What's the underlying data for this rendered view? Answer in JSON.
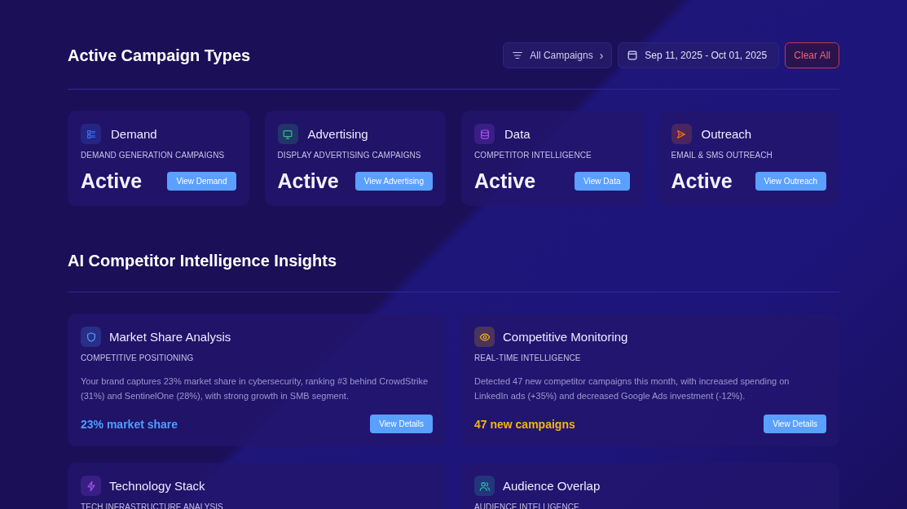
{
  "header": {
    "title": "Active Campaign Types",
    "filter": {
      "label": "All Campaigns",
      "caret": "›"
    },
    "date_range": "Sep 11, 2025 - Oct 01, 2025",
    "clear_button": "Clear All"
  },
  "campaign_types": [
    {
      "kind": "list",
      "color": "#3b6ef5",
      "title": "Demand",
      "subtitle": "DEMAND GENERATION CAMPAIGNS",
      "status": "Active",
      "button": "View Demand"
    },
    {
      "kind": "monitor",
      "color": "#2fbf7a",
      "title": "Advertising",
      "subtitle": "DISPLAY ADVERTISING CAMPAIGNS",
      "status": "Active",
      "button": "View Advertising"
    },
    {
      "kind": "database",
      "color": "#a24ff0",
      "title": "Data",
      "subtitle": "COMPETITOR INTELLIGENCE",
      "status": "Active",
      "button": "View Data"
    },
    {
      "kind": "send",
      "color": "#f26a1b",
      "title": "Outreach",
      "subtitle": "EMAIL & SMS OUTREACH",
      "status": "Active",
      "button": "View Outreach"
    }
  ],
  "insights_section": {
    "title": "AI Competitor Intelligence Insights"
  },
  "insights": [
    {
      "kind": "shield",
      "color": "#4f9dff",
      "title": "Market Share Analysis",
      "subtitle": "COMPETITIVE POSITIONING",
      "description": "Your brand captures 23% market share in cybersecurity, ranking #3 behind CrowdStrike (31%) and SentinelOne (28%), with strong growth in SMB segment.",
      "metric": "23% market share",
      "button": "View Details"
    },
    {
      "kind": "eye",
      "color": "#f5b50b",
      "title": "Competitive Monitoring",
      "subtitle": "REAL-TIME INTELLIGENCE",
      "description": "Detected 47 new competitor campaigns this month, with increased spending on LinkedIn ads (+35%) and decreased Google Ads investment (-12%).",
      "metric": "47 new campaigns",
      "button": "View Details"
    },
    {
      "kind": "bolt",
      "color": "#a24ff0",
      "title": "Technology Stack",
      "subtitle": "TECH INFRASTRUCTURE ANALYSIS"
    },
    {
      "kind": "users",
      "color": "#2dbfa8",
      "title": "Audience Overlap",
      "subtitle": "AUDIENCE INTELLIGENCE"
    }
  ]
}
